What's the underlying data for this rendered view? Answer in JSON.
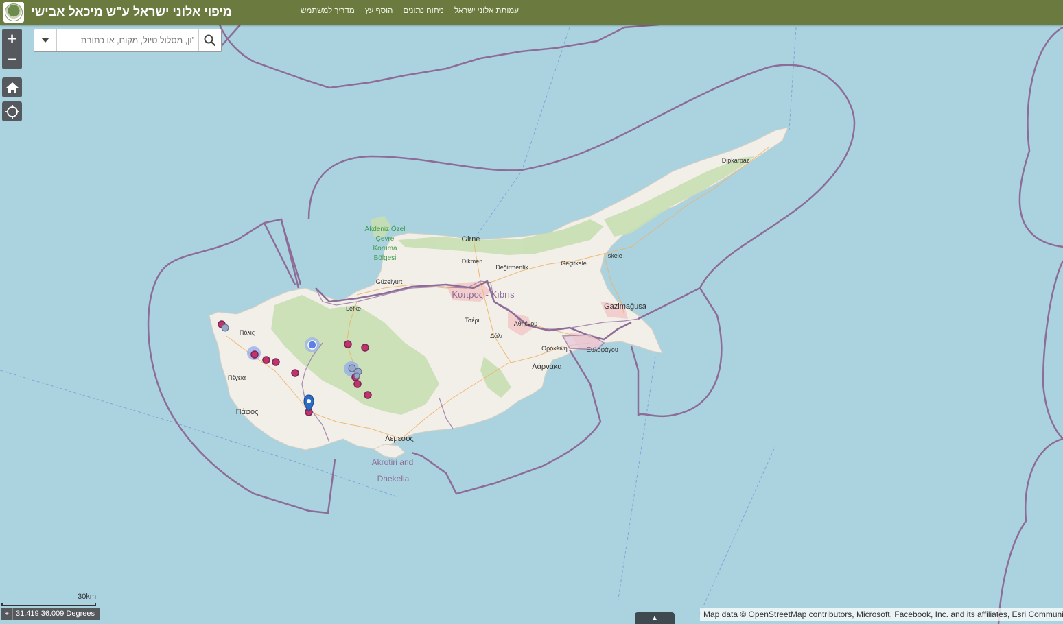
{
  "header": {
    "title": "מיפוי אלוני ישראל ע\"ש מיכאל אבישי",
    "nav": [
      "עמותת אלוני ישראל",
      "ניתוח נתונים",
      "הוסף עץ",
      "מדריך למשתמש"
    ]
  },
  "search": {
    "placeholder": "'ון, מסלול טיול, מקום, או כתובת"
  },
  "zoom": {
    "in": "+",
    "out": "−"
  },
  "scale": {
    "label": "30km"
  },
  "coordinates": {
    "text": "31.419 36.009 Degrees"
  },
  "attribution": "Map data © OpenStreetMap contributors, Microsoft, Facebook, Inc. and its affiliates, Esri Community Maps contributors",
  "colors": {
    "header": "#6b7a3e",
    "sea": "#aad3df",
    "land": "#f2efe9",
    "forest": "#c8dfb2",
    "boundary": "#8e6c98",
    "marker": "#c0336d"
  },
  "map_labels": {
    "girne": "Girne",
    "dikmen": "Dikmen",
    "degirmenlik": "Değirmenlik",
    "gecitkale": "Geçitkale",
    "iskele": "İskele",
    "dipkarpaz": "Dipkarpaz",
    "guzelyurt": "Güzelyurt",
    "lefke": "Lefke",
    "kypros": "Κύπρος - Kıbrıs",
    "gazimagusa": "Gazimağusa",
    "tseri": "Τσέρι",
    "athienou": "Αθηένου",
    "dali": "Δάλι",
    "oroklini": "Ορόκλινη",
    "xylofagou": "Ξυλοφάγου",
    "larnaka": "Λάρνακα",
    "polis": "Πόλις",
    "peyia": "Πέγεια",
    "pafos": "Πάφος",
    "lemesos": "Λεμεσός",
    "akrotiri_1": "Akrotiri and",
    "akrotiri_2": "Dhekelia",
    "park_1": "Akdeniz Özel",
    "park_2": "Çevre",
    "park_3": "Koruma",
    "park_4": "Bölgesi"
  }
}
